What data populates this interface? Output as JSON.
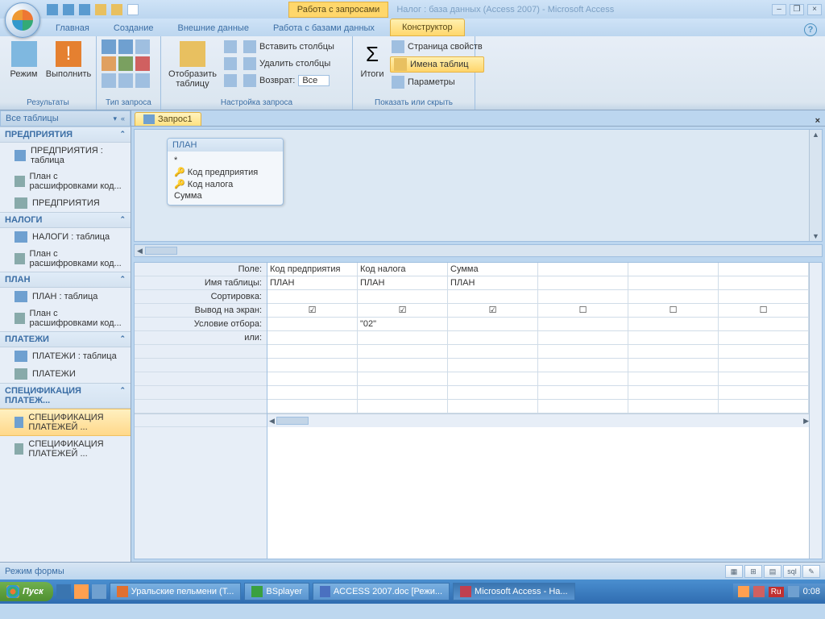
{
  "title": {
    "contextual": "Работа с запросами",
    "app": "Налог : база данных (Access 2007) - Microsoft Access"
  },
  "ribbon_tabs": {
    "home": "Главная",
    "create": "Создание",
    "external": "Внешние данные",
    "dbtools": "Работа с базами данных",
    "design": "Конструктор"
  },
  "ribbon": {
    "results": {
      "view": "Режим",
      "run": "Выполнить",
      "group": "Результаты"
    },
    "qtype": {
      "group": "Тип запроса"
    },
    "setup": {
      "show_table": "Отобразить\nтаблицу",
      "insert_cols": "Вставить столбцы",
      "delete_cols": "Удалить столбцы",
      "return_lbl": "Возврат:",
      "return_val": "Все",
      "group": "Настройка запроса"
    },
    "totals": {
      "label": "Итоги"
    },
    "showhide": {
      "prop_sheet": "Страница свойств",
      "table_names": "Имена таблиц",
      "params": "Параметры",
      "group": "Показать или скрыть"
    }
  },
  "navpane": {
    "header": "Все таблицы",
    "g1": {
      "hd": "ПРЕДПРИЯТИЯ",
      "i1": "ПРЕДПРИЯТИЯ : таблица",
      "i2": "План с расшифровками код...",
      "i3": "ПРЕДПРИЯТИЯ"
    },
    "g2": {
      "hd": "НАЛОГИ",
      "i1": "НАЛОГИ : таблица",
      "i2": "План с расшифровками код..."
    },
    "g3": {
      "hd": "ПЛАН",
      "i1": "ПЛАН : таблица",
      "i2": "План с расшифровками код..."
    },
    "g4": {
      "hd": "ПЛАТЕЖИ",
      "i1": "ПЛАТЕЖИ : таблица",
      "i2": "ПЛАТЕЖИ"
    },
    "g5": {
      "hd": "СПЕЦИФИКАЦИЯ ПЛАТЕЖ...",
      "i1": "СПЕЦИФИКАЦИЯ ПЛАТЕЖЕЙ ...",
      "i2": "СПЕЦИФИКАЦИЯ ПЛАТЕЖЕЙ ..."
    }
  },
  "doc": {
    "tab": "Запрос1"
  },
  "table_box": {
    "title": "ПЛАН",
    "star": "*",
    "f1": "Код предприятия",
    "f2": "Код налога",
    "f3": "Сумма"
  },
  "grid": {
    "labels": {
      "field": "Поле:",
      "table": "Имя таблицы:",
      "sort": "Сортировка:",
      "show": "Вывод на экран:",
      "criteria": "Условие отбора:",
      "or": "или:"
    },
    "c1": {
      "field": "Код предприятия",
      "table": "ПЛАН",
      "show": true
    },
    "c2": {
      "field": "Код налога",
      "table": "ПЛАН",
      "show": true,
      "criteria": "\"02\""
    },
    "c3": {
      "field": "Сумма",
      "table": "ПЛАН",
      "show": true
    }
  },
  "status": {
    "label": "Режим формы"
  },
  "taskbar": {
    "start": "Пуск",
    "t1": "Уральские пельмени (Т...",
    "t2": "BSplayer",
    "t3": "ACCESS 2007.doc [Режи...",
    "t4": "Microsoft Access - На...",
    "lang": "Ru",
    "time": "0:08"
  }
}
